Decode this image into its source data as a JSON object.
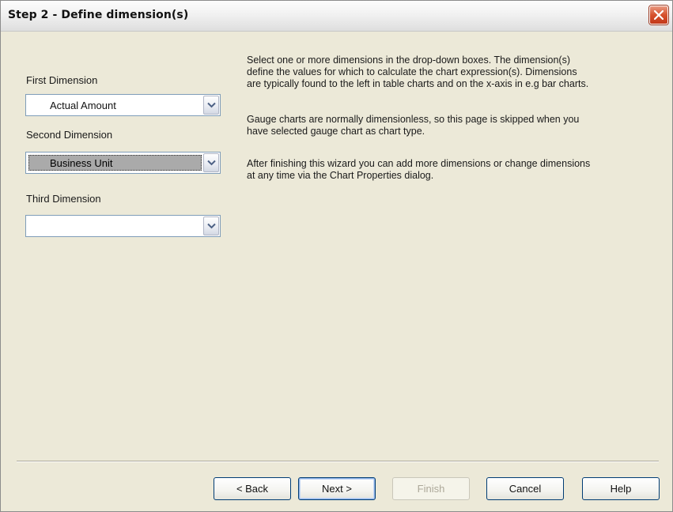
{
  "window": {
    "title": "Step 2 - Define dimension(s)",
    "close_icon": "close-icon"
  },
  "dimensions": {
    "first": {
      "label": "First Dimension",
      "value": "Actual Amount"
    },
    "second": {
      "label": "Second Dimension",
      "value": "Business Unit"
    },
    "third": {
      "label": "Third Dimension",
      "value": ""
    }
  },
  "description": {
    "paragraph1": [
      "Select one or more dimensions in the drop-down boxes. The dimension(s)",
      "define the values for which to calculate the chart expression(s). Dimensions",
      "are typically found to the left in table charts and on the x-axis in e.g bar charts."
    ],
    "paragraph2": [
      "Gauge charts are normally dimensionless, so this page is skipped when you",
      "have selected gauge chart as chart type."
    ],
    "paragraph3": [
      "After finishing this wizard you can add more dimensions or change dimensions",
      "at any time via the Chart Properties dialog."
    ]
  },
  "buttons": {
    "back": "< Back",
    "next": "Next >",
    "finish": "Finish",
    "cancel": "Cancel",
    "help": "Help"
  },
  "colors": {
    "dialog_bg": "#ece9d8",
    "close_button": "#d6512d",
    "selected_fill": "#aaaaaa"
  }
}
